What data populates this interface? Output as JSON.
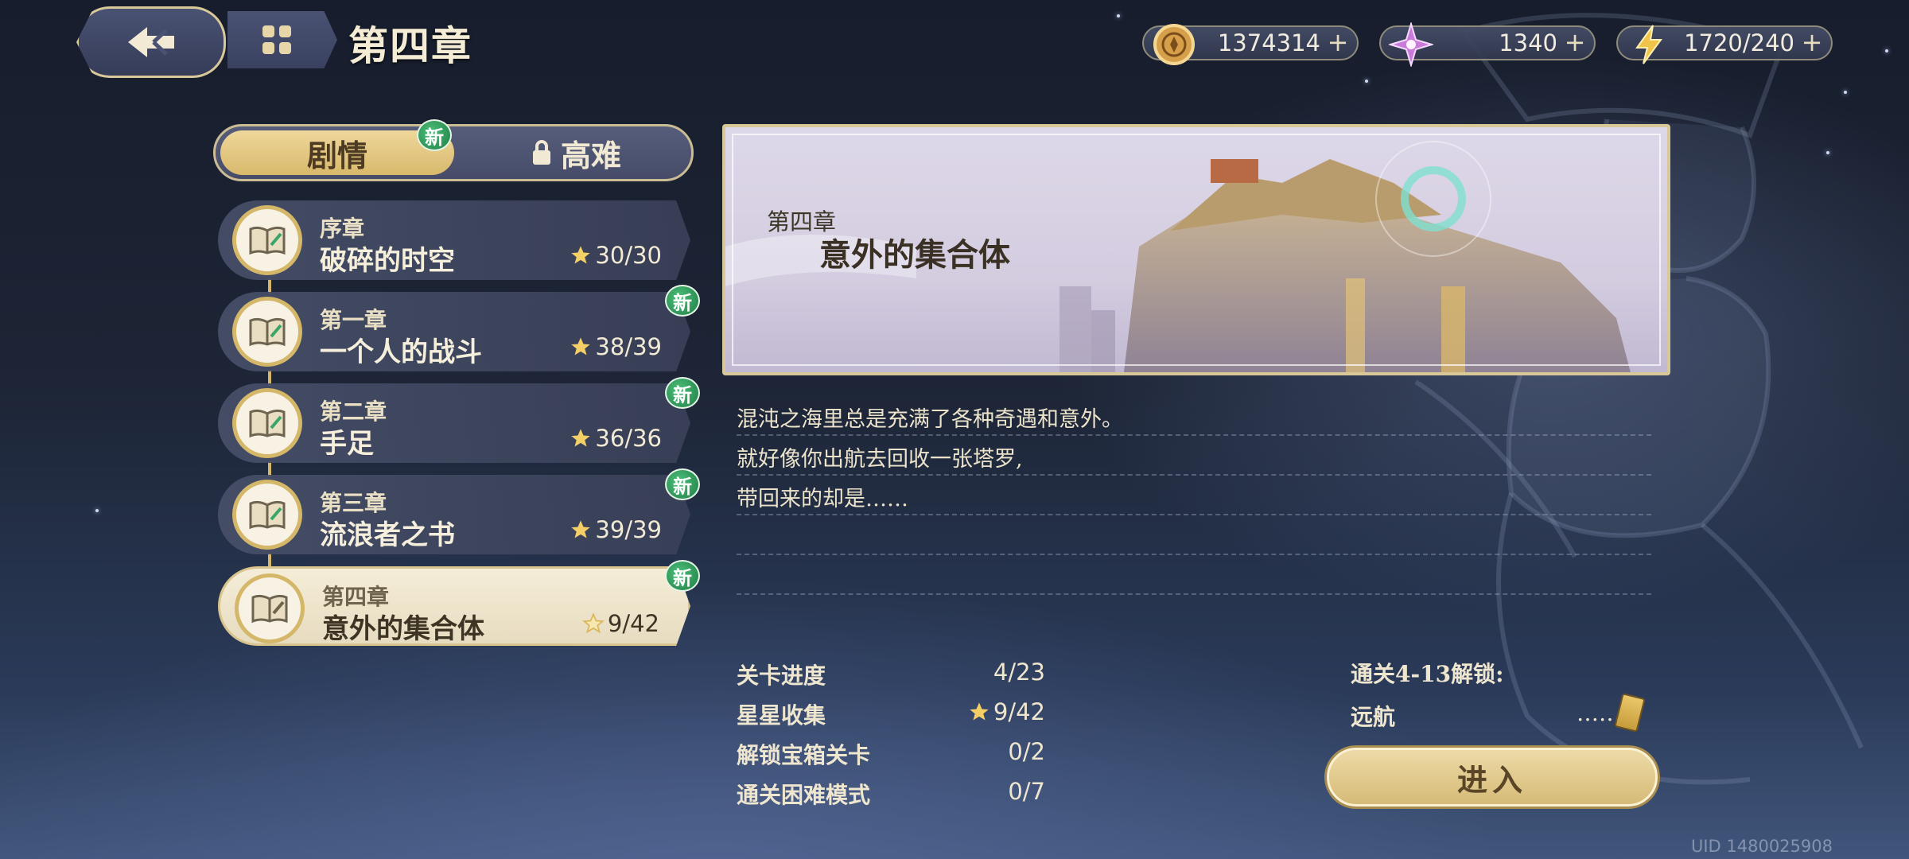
{
  "header": {
    "title": "第四章"
  },
  "currencies": [
    {
      "icon": "coin-icon",
      "value": "1374314"
    },
    {
      "icon": "crystal-icon",
      "value": "1340"
    },
    {
      "icon": "energy-icon",
      "value": "1720/240"
    }
  ],
  "tabs": [
    {
      "label": "剧情",
      "badge": "新",
      "selected": true
    },
    {
      "label": "高难",
      "locked": true
    }
  ],
  "chapters": [
    {
      "sub": "序章",
      "name": "破碎的时空",
      "stars": "30/30",
      "badge": ""
    },
    {
      "sub": "第一章",
      "name": "一个人的战斗",
      "stars": "38/39",
      "badge": "新"
    },
    {
      "sub": "第二章",
      "name": "手足",
      "stars": "36/36",
      "badge": "新"
    },
    {
      "sub": "第三章",
      "name": "流浪者之书",
      "stars": "39/39",
      "badge": "新"
    },
    {
      "sub": "第四章",
      "name": "意外的集合体",
      "stars": "9/42",
      "badge": "新",
      "active": true
    }
  ],
  "banner": {
    "sub": "第四章",
    "title": "意外的集合体"
  },
  "description": [
    "混沌之海里总是充满了各种奇遇和意外。",
    "就好像你出航去回收一张塔罗,",
    "带回来的却是……"
  ],
  "stats": [
    {
      "label": "关卡进度",
      "value": "4/23"
    },
    {
      "label": "星星收集",
      "value": "9/42",
      "star": true
    },
    {
      "label": "解锁宝箱关卡",
      "value": "0/2"
    },
    {
      "label": "通关困难模式",
      "value": "0/7"
    }
  ],
  "unlock": {
    "title": "通关4-13解锁:",
    "item": "远航",
    "dots": "……"
  },
  "enter_label": "进入",
  "uid": "UID 1480025908",
  "colors": {
    "gold": "#d4b768",
    "panel": "#464c68",
    "new_badge": "#1e7d45"
  }
}
